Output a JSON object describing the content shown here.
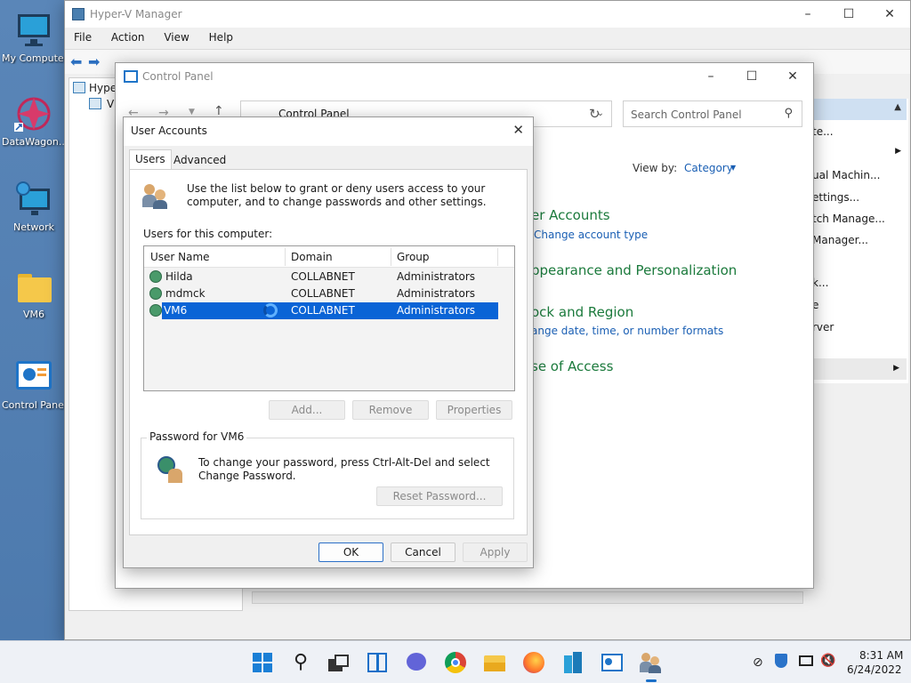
{
  "desktop": {
    "icons": [
      {
        "label": "My Computer"
      },
      {
        "label": "DataWagon..."
      },
      {
        "label": "Network"
      },
      {
        "label": "VM6"
      },
      {
        "label": "Control Panel"
      }
    ]
  },
  "hyperv": {
    "title": "Hyper-V Manager",
    "menu": [
      "File",
      "Action",
      "Help",
      "View"
    ],
    "tree": {
      "root": "Hyper",
      "child": "VI"
    },
    "actions": [
      "te...",
      "ual Machin...",
      "ettings...",
      "tch Manage...",
      "Manager...",
      "k...",
      "e",
      "rver"
    ]
  },
  "control_panel": {
    "title": "Control Panel",
    "address": "Control Panel",
    "search_placeholder": "Search Control Panel",
    "view_by_label": "View by:",
    "view_by_value": "Category",
    "links": {
      "user_accounts": "er Accounts",
      "change_account_type": "Change account type",
      "appearance": "ppearance and Personalization",
      "clock_region": "ock and Region",
      "change_date": "ange date, time, or number formats",
      "ease_of_access": "se of Access"
    }
  },
  "dialog": {
    "title": "User Accounts",
    "tabs": {
      "users": "Users",
      "advanced": "Advanced"
    },
    "intro": "Use the list below to grant or deny users access to your computer, and to change passwords and other settings.",
    "users_label": "Users for this computer:",
    "columns": {
      "name": "User Name",
      "domain": "Domain",
      "group": "Group"
    },
    "rows": [
      {
        "name": "Hilda",
        "domain": "COLLABNET",
        "group": "Administrators"
      },
      {
        "name": "mdmck",
        "domain": "COLLABNET",
        "group": "Administrators"
      },
      {
        "name": "VM6",
        "domain": "COLLABNET",
        "group": "Administrators"
      }
    ],
    "buttons": {
      "add": "Add...",
      "remove": "Remove",
      "properties": "Properties",
      "reset": "Reset Password...",
      "ok": "OK",
      "cancel": "Cancel",
      "apply": "Apply"
    },
    "password_group": "Password for VM6",
    "password_text": "To change your password, press Ctrl-Alt-Del and select Change Password."
  },
  "taskbar": {
    "time": "8:31 AM",
    "date": "6/24/2022"
  },
  "colors": {
    "accent": "#0a64d6",
    "cp_link": "#1b7a3c",
    "cp_sublink": "#1a5fb4"
  }
}
